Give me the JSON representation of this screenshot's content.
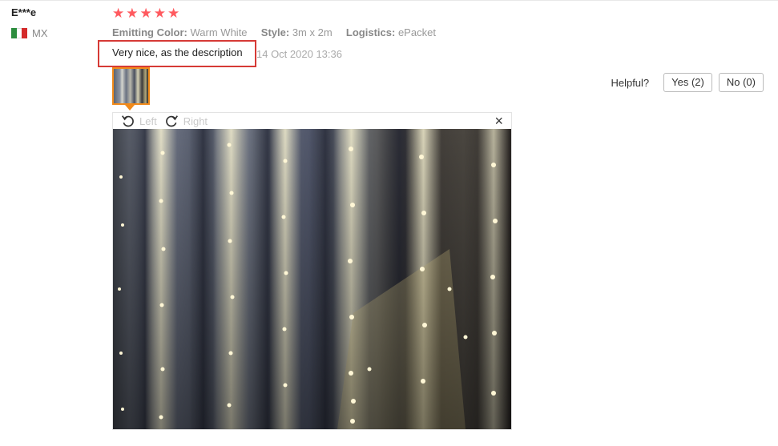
{
  "review": {
    "user_name": "E***e",
    "country_code": "MX",
    "flag_colors": [
      "#2c8d3e",
      "#ffffff",
      "#d42b2b"
    ],
    "rating": 5,
    "star_glyph": "★",
    "attributes": [
      {
        "key": "Emitting Color:",
        "value": "Warm White"
      },
      {
        "key": "Style:",
        "value": "3m x 2m"
      },
      {
        "key": "Logistics:",
        "value": "ePacket"
      }
    ],
    "feedback_text": "Very nice, as the description",
    "date": "14 Oct 2020 13:36",
    "highlight_color": "#d63a36"
  },
  "helpful": {
    "label": "Helpful?",
    "yes_label": "Yes (2)",
    "no_label": "No (0)"
  },
  "viewer": {
    "rotate_left_label": "Left",
    "rotate_right_label": "Right",
    "close_glyph": "×"
  },
  "theme": {
    "star_color": "#ff5a5f",
    "thumb_border": "#f18a1a"
  }
}
